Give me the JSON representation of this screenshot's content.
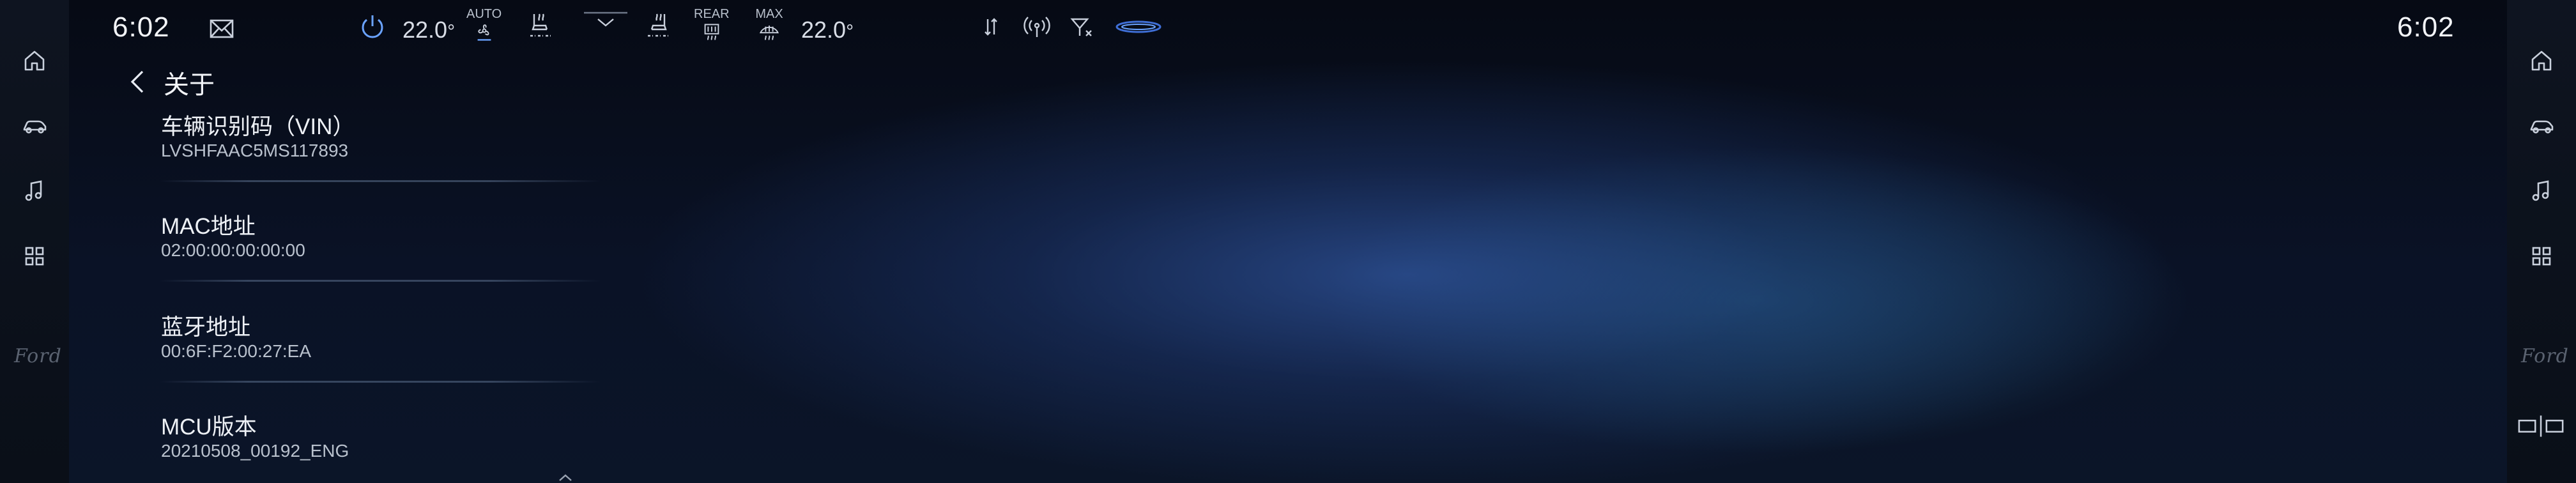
{
  "status_bar": {
    "time_left": "6:02",
    "time_right": "6:02",
    "driver_temp": "22.0",
    "passenger_temp": "22.0",
    "temp_unit": "°",
    "fan_label": "AUTO",
    "rear_defrost_label": "REAR",
    "max_defrost_label": "MAX"
  },
  "page": {
    "title": "关于"
  },
  "items": [
    {
      "label": "车辆识别码（VIN）",
      "value": "LVSHFAAC5MS117893"
    },
    {
      "label": "MAC地址",
      "value": "02:00:00:00:00:00"
    },
    {
      "label": "蓝牙地址",
      "value": "00:6F:F2:00:27:EA"
    },
    {
      "label": "MCU版本",
      "value": "20210508_00192_ENG"
    }
  ],
  "brand": {
    "logo_text": "Ford"
  },
  "colors": {
    "accent": "#4a78d8",
    "background": "#0a1226",
    "rail": "#0e1420"
  }
}
